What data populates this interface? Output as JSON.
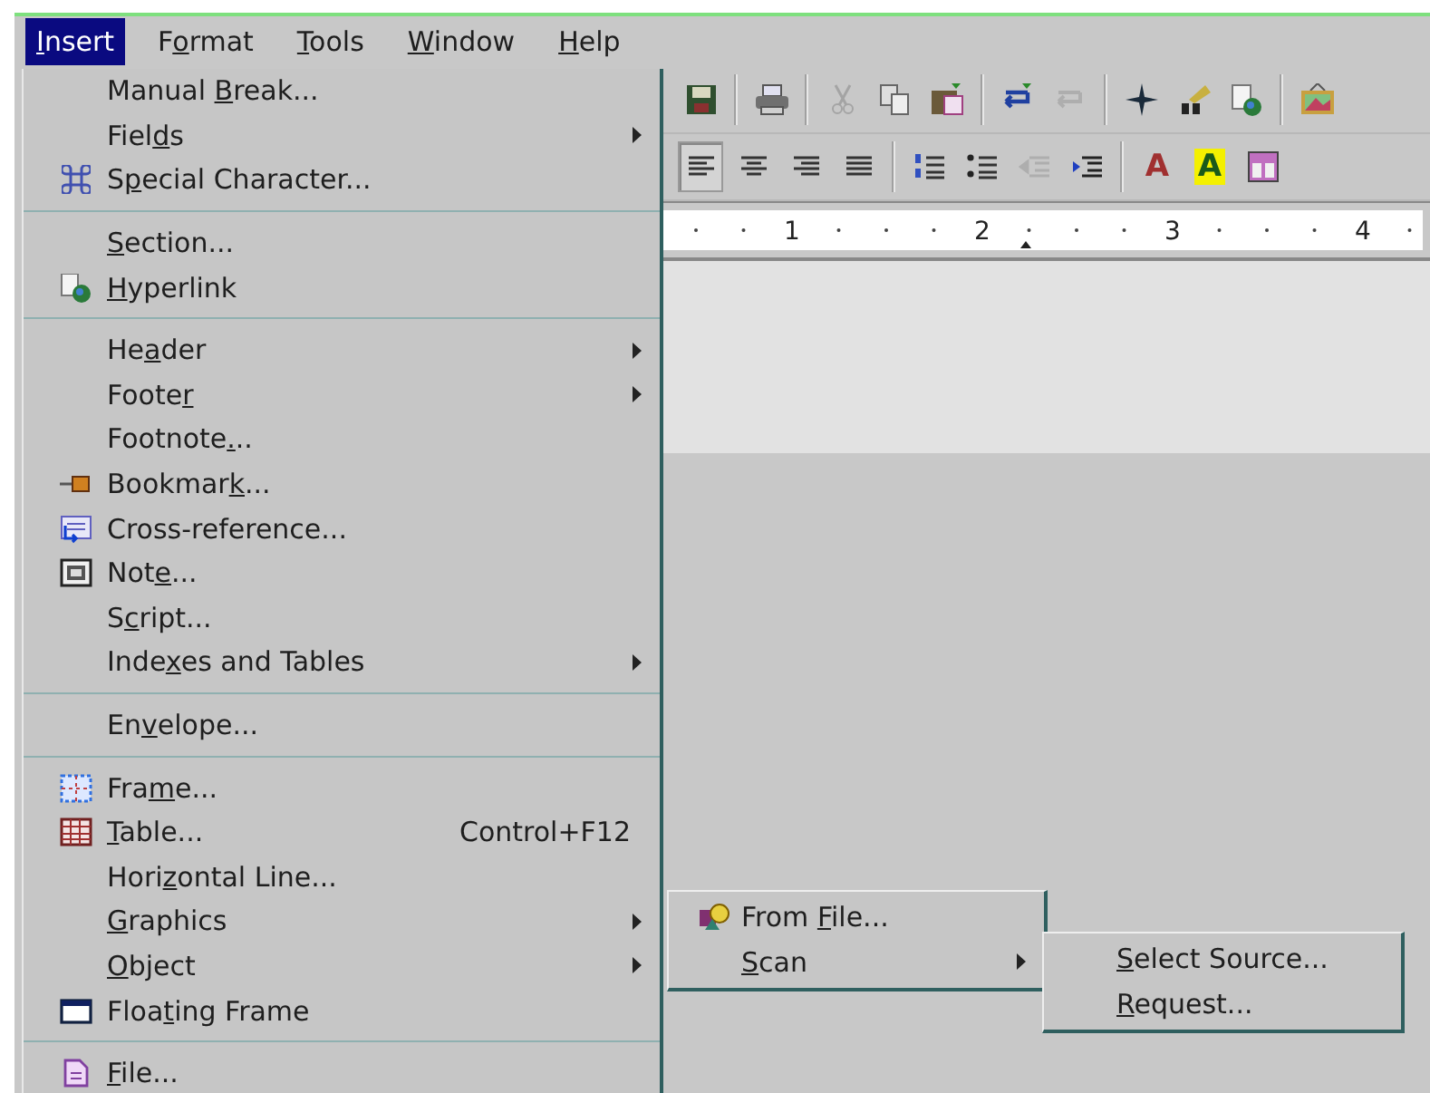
{
  "menubar": [
    {
      "key": "I",
      "post": "nsert",
      "selected": true
    },
    {
      "pre": "F",
      "key": "o",
      "post": "rmat",
      "selected": false
    },
    {
      "key": "T",
      "post": "ools",
      "selected": false
    },
    {
      "key": "W",
      "post": "indow",
      "selected": false
    },
    {
      "key": "H",
      "post": "elp",
      "selected": false
    }
  ],
  "toolbars": [
    {
      "groups": [
        {
          "buttons": [
            {
              "kind": "icon",
              "disabled": false,
              "selected": false
            }
          ]
        },
        {
          "buttons": [
            {
              "kind": "icon",
              "disabled": false,
              "selected": false
            }
          ]
        },
        {
          "buttons": [
            {
              "kind": "icon",
              "disabled": true,
              "selected": false
            },
            {
              "kind": "icon",
              "disabled": false,
              "selected": false
            },
            {
              "kind": "icon",
              "disabled": false,
              "selected": false
            }
          ]
        },
        {
          "buttons": [
            {
              "kind": "icon",
              "disabled": false,
              "selected": false
            },
            {
              "kind": "icon",
              "disabled": true,
              "selected": false
            }
          ]
        },
        {
          "buttons": [
            {
              "kind": "icon",
              "disabled": false,
              "selected": false
            },
            {
              "kind": "icon",
              "disabled": false,
              "selected": false
            },
            {
              "kind": "icon",
              "disabled": false,
              "selected": false
            }
          ]
        },
        {
          "buttons": [
            {
              "kind": "icon",
              "disabled": false,
              "selected": false
            }
          ]
        }
      ]
    },
    {
      "groups": [
        {
          "buttons": [
            {
              "kind": "icon",
              "disabled": false,
              "selected": true
            },
            {
              "kind": "icon",
              "disabled": false,
              "selected": false
            },
            {
              "kind": "icon",
              "disabled": false,
              "selected": false
            },
            {
              "kind": "icon",
              "disabled": false,
              "selected": false
            }
          ]
        },
        {
          "buttons": [
            {
              "kind": "icon",
              "disabled": false,
              "selected": false
            },
            {
              "kind": "icon",
              "disabled": false,
              "selected": false
            },
            {
              "kind": "icon",
              "disabled": true,
              "selected": false
            },
            {
              "kind": "icon",
              "disabled": false,
              "selected": false
            }
          ]
        },
        {
          "buttons": [
            {
              "kind": "glyph",
              "text": "A",
              "highlight": false,
              "disabled": false,
              "selected": false
            },
            {
              "kind": "glyph",
              "text": "A",
              "highlight": true,
              "disabled": false,
              "selected": false
            },
            {
              "kind": "icon",
              "disabled": false,
              "selected": false
            }
          ]
        }
      ]
    }
  ],
  "ruler": {
    "marks": [
      "1",
      "2",
      "3",
      "4"
    ]
  },
  "menu": {
    "sections": [
      {
        "items": [
          {
            "pre": "Manual ",
            "key": "B",
            "post": "reak...",
            "submenu": false
          },
          {
            "pre": "Fiel",
            "key": "d",
            "post": "s",
            "submenu": true
          },
          {
            "pre": "S",
            "key": "p",
            "post": "ecial Character...",
            "submenu": false
          }
        ]
      },
      {
        "items": [
          {
            "key": "S",
            "post": "ection...",
            "submenu": false
          },
          {
            "key": "H",
            "post": "yperlink",
            "submenu": false
          }
        ]
      },
      {
        "items": [
          {
            "pre": "He",
            "key": "a",
            "post": "der",
            "submenu": true
          },
          {
            "pre": "Foote",
            "key": "r",
            "submenu": true
          },
          {
            "pre": "Footnote",
            "key": ".",
            "post": "..",
            "submenu": false
          },
          {
            "pre": "Bookmar",
            "key": "k",
            "post": "...",
            "submenu": false
          },
          {
            "pre": "Cross-reference...",
            "submenu": false
          },
          {
            "pre": "Not",
            "key": "e",
            "post": "...",
            "submenu": false
          },
          {
            "pre": "S",
            "key": "c",
            "post": "ript...",
            "submenu": false
          },
          {
            "pre": "Inde",
            "key": "x",
            "post": "es and Tables",
            "submenu": true
          }
        ]
      },
      {
        "items": [
          {
            "pre": "En",
            "key": "v",
            "post": "elope...",
            "submenu": false
          }
        ]
      },
      {
        "items": [
          {
            "pre": "Fra",
            "key": "m",
            "post": "e...",
            "submenu": false
          },
          {
            "key": "T",
            "post": "able...",
            "shortcut": "Control+F12",
            "submenu": false
          },
          {
            "pre": "Hori",
            "key": "z",
            "post": "ontal Line...",
            "submenu": false
          },
          {
            "key": "G",
            "post": "raphics",
            "submenu": true
          },
          {
            "key": "O",
            "post": "bject",
            "submenu": true
          },
          {
            "pre": "Floa",
            "key": "t",
            "post": "ing Frame",
            "submenu": false
          }
        ]
      },
      {
        "items": [
          {
            "key": "F",
            "post": "ile...",
            "submenu": false
          }
        ]
      }
    ]
  },
  "graphics_submenu": {
    "items": [
      {
        "pre": "From ",
        "key": "F",
        "post": "ile...",
        "submenu": false
      },
      {
        "key": "S",
        "post": "can",
        "submenu": true
      }
    ]
  },
  "scan_submenu": {
    "items": [
      {
        "key": "S",
        "post": "elect Source...",
        "submenu": false
      },
      {
        "key": "R",
        "post": "equest...",
        "submenu": false
      }
    ]
  }
}
